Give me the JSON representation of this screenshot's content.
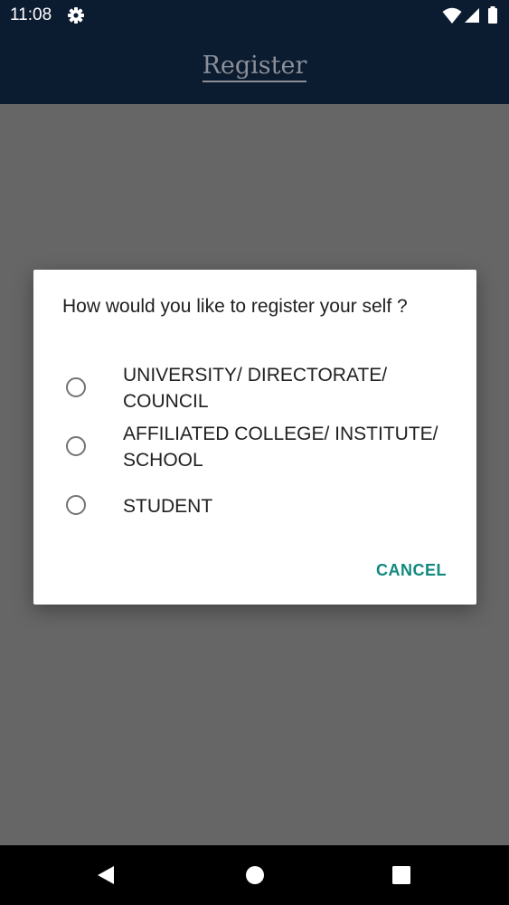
{
  "status_bar": {
    "time": "11:08",
    "icons": [
      "settings-icon",
      "wifi-icon",
      "signal-icon",
      "battery-icon"
    ]
  },
  "app_bar": {
    "title": "Register"
  },
  "dialog": {
    "title": "How would you like to register your self ?",
    "options": [
      {
        "label": "UNIVERSITY/ DIRECTORATE/ COUNCIL",
        "selected": false
      },
      {
        "label": "AFFILIATED COLLEGE/ INSTITUTE/ SCHOOL",
        "selected": false
      },
      {
        "label": "STUDENT",
        "selected": false
      }
    ],
    "cancel_label": "CANCEL"
  },
  "navigation": {
    "icons": [
      "back-icon",
      "home-icon",
      "recents-icon"
    ]
  },
  "colors": {
    "bar_background": "#0b1b30",
    "scrim": "#666666",
    "accent": "#11897e",
    "title_text": "#8a8f98"
  }
}
